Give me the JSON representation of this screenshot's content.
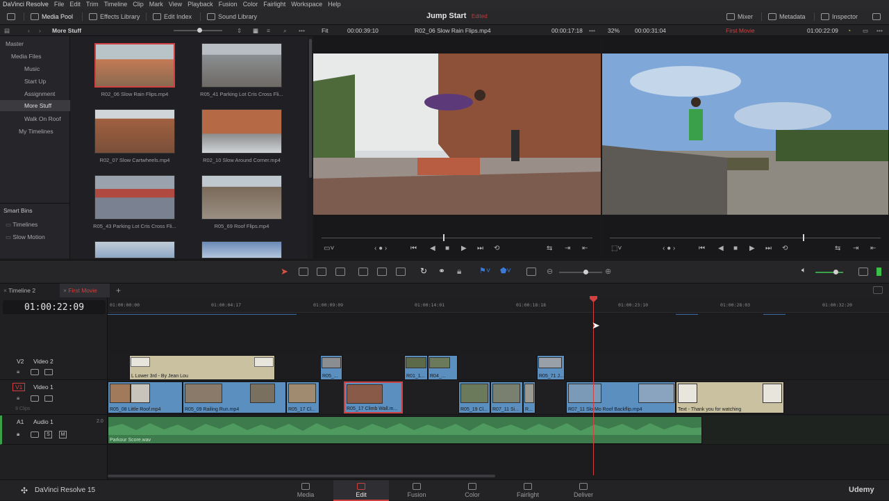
{
  "menubar": {
    "app_name": "DaVinci Resolve",
    "items": [
      "File",
      "Edit",
      "Trim",
      "Timeline",
      "Clip",
      "Mark",
      "View",
      "Playback",
      "Fusion",
      "Color",
      "Fairlight",
      "Workspace",
      "Help"
    ]
  },
  "toolbar": {
    "media_pool": "Media Pool",
    "effects_library": "Effects Library",
    "edit_index": "Edit Index",
    "sound_library": "Sound Library",
    "project_title": "Jump Start",
    "project_status": "Edited",
    "mixer": "Mixer",
    "metadata": "Metadata",
    "inspector": "Inspector"
  },
  "subbar": {
    "bin_title": "More Stuff",
    "fit_label": "Fit",
    "src_timecode": "00:00:39:10",
    "src_clip": "R02_06 Slow Rain Flips.mp4",
    "src_position": "00:00:17:18",
    "zoom": "32%",
    "rec_duration": "00:00:31:04",
    "timeline_name": "First Movie",
    "rec_timecode": "01:00:22:09"
  },
  "bins": {
    "items": [
      {
        "label": "Master",
        "indent": 0
      },
      {
        "label": "Media Files",
        "indent": 1
      },
      {
        "label": "Music",
        "indent": 2
      },
      {
        "label": "Start Up",
        "indent": 2
      },
      {
        "label": "Assignment",
        "indent": 2
      },
      {
        "label": "More Stuff",
        "indent": 2,
        "selected": true
      },
      {
        "label": "Walk On Roof",
        "indent": 2
      },
      {
        "label": "My Timelines",
        "indent": 1
      }
    ],
    "smart_bins_label": "Smart Bins",
    "smart_items": [
      "Timelines",
      "Slow Motion"
    ]
  },
  "pool": {
    "clips": [
      {
        "name": "R02_06 Slow Rain Flips.mp4",
        "selected": true,
        "palette": [
          "#c47a55",
          "#8a6a50",
          "#b9c4c8"
        ]
      },
      {
        "name": "R05_41 Parking Lot Cris Cross Fli...",
        "selected": false,
        "palette": [
          "#8a8e90",
          "#6e6a66",
          "#b8bec4"
        ]
      },
      {
        "name": "R02_07 Slow Cartwheels.mp4",
        "selected": false,
        "palette": [
          "#a06040",
          "#7a4f3a",
          "#cfd5d8"
        ]
      },
      {
        "name": "R02_10 Slow Around Corner.mp4",
        "selected": false,
        "palette": [
          "#b56a45",
          "#8c8c8c",
          "#d0d4d8"
        ]
      },
      {
        "name": "R05_43 Parking Lot Cris Cross Fli...",
        "selected": false,
        "palette": [
          "#9aa3ad",
          "#b04a40",
          "#7a8190"
        ]
      },
      {
        "name": "R05_69 Roof Flips.mp4",
        "selected": false,
        "palette": [
          "#7a6a5a",
          "#9a8f82",
          "#c0c8cf"
        ]
      },
      {
        "name": "",
        "selected": false,
        "palette": [
          "#8fa7c4",
          "#c0ccd8",
          "#7a8a9a"
        ]
      },
      {
        "name": "",
        "selected": false,
        "palette": [
          "#6a8ab8",
          "#b4c6dc",
          "#3a4a60"
        ]
      }
    ]
  },
  "timeline": {
    "tabs": [
      "Timeline 2",
      "First Movie"
    ],
    "current_timecode": "01:00:22:09",
    "ruler_ticks": [
      "01:00:00:00",
      "01:00:04:17",
      "01:00:09:09",
      "01:00:14:01",
      "01:00:18:18",
      "01:00:23:10",
      "01:00:28:03",
      "01:00:32:20"
    ],
    "tracks": [
      {
        "id": "V2",
        "name": "Video 2"
      },
      {
        "id": "V1",
        "name": "Video 1",
        "clip_count": "9 Clips"
      },
      {
        "id": "A1",
        "name": "Audio 1",
        "channels": "2.0"
      }
    ],
    "v2_clips": [
      {
        "label": "L Lower 3rd - By Jean Lou",
        "kind": "title"
      },
      {
        "label": "R05_...",
        "kind": "video"
      },
      {
        "label": "R01_1...",
        "kind": "video"
      },
      {
        "label": "R04_...",
        "kind": "video"
      },
      {
        "label": "R05_71 J...",
        "kind": "video"
      }
    ],
    "v1_clips": [
      {
        "label": "R05_08 Little Roof.mp4",
        "kind": "video"
      },
      {
        "label": "R05_09 Railing Run.mp4",
        "kind": "video"
      },
      {
        "label": "R05_17 Cl...",
        "kind": "video"
      },
      {
        "label": "R05_17 Climb Wall.m...",
        "kind": "video",
        "selected": true
      },
      {
        "label": "R05_19 Cl...",
        "kind": "video"
      },
      {
        "label": "R07_11 Si...",
        "kind": "video"
      },
      {
        "label": "R...",
        "kind": "video"
      },
      {
        "label": "R07_11 Slo Mo Roof Backflip.mp4",
        "kind": "video"
      },
      {
        "label": "Text - Thank you for watching",
        "kind": "title"
      }
    ],
    "a1_clip": {
      "label": "Parkour Score.wav"
    }
  },
  "pages": [
    {
      "label": "Media"
    },
    {
      "label": "Edit",
      "active": true
    },
    {
      "label": "Fusion"
    },
    {
      "label": "Color"
    },
    {
      "label": "Fairlight"
    },
    {
      "label": "Deliver"
    }
  ],
  "brand": {
    "product": "DaVinci Resolve 15",
    "watermark": "Udemy"
  },
  "colors": {
    "accent_red": "#d04040",
    "video_clip": "#5b8fc0",
    "title_clip": "#c9c1a0",
    "audio_clip": "#3d7a4c"
  }
}
